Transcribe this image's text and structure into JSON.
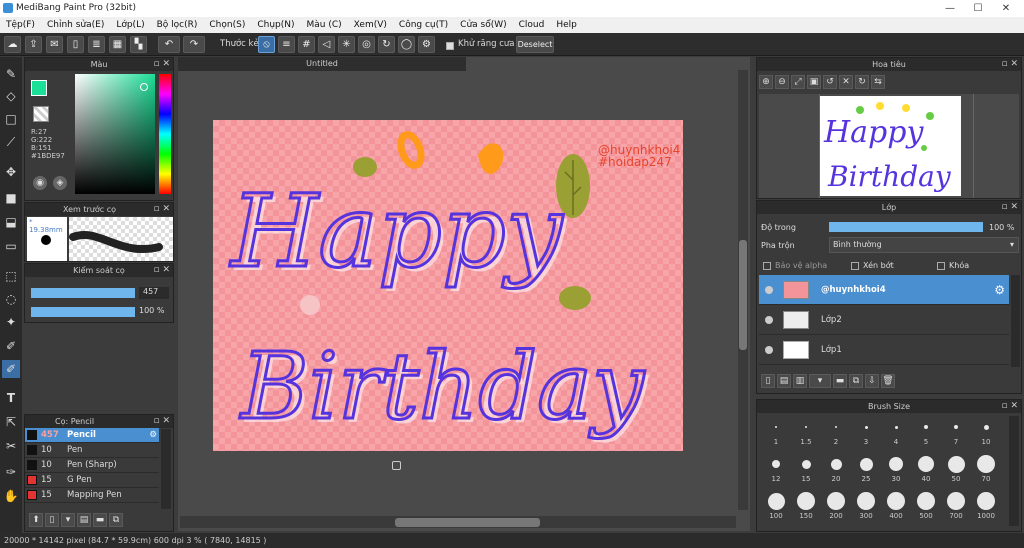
{
  "window": {
    "title": "MediBang Paint Pro (32bit)",
    "minimize": "—",
    "maximize": "☐",
    "close": "✕"
  },
  "menu": [
    "Tệp(F)",
    "Chỉnh sửa(E)",
    "Lớp(L)",
    "Bộ lọc(R)",
    "Chọn(S)",
    "Chụp(N)",
    "Màu (C)",
    "Xem(V)",
    "Công cụ(T)",
    "Cửa sổ(W)",
    "Cloud",
    "Help"
  ],
  "toolbar": {
    "stroke_label": "Thước kẻ",
    "antialias_label": "Khử răng cưa",
    "deselect_label": "Deselect"
  },
  "color_panel": {
    "title": "Màu",
    "r": "R:27",
    "g": "G:222",
    "b": "B:151",
    "hex": "#1BDE97",
    "primary": "#1bde97"
  },
  "brush_preview": {
    "title": "Xem trước cọ",
    "size": "* 19.38mm"
  },
  "brush_control": {
    "title": "Kiểm soát cọ",
    "size_value": "457",
    "opacity_value": "100 %"
  },
  "brush_list": {
    "title": "Cọ: Pencil",
    "items": [
      {
        "size": "457",
        "name": "Pencil",
        "color": "#111111"
      },
      {
        "size": "10",
        "name": "Pen",
        "color": "#111111"
      },
      {
        "size": "10",
        "name": "Pen (Sharp)",
        "color": "#111111"
      },
      {
        "size": "15",
        "name": "G Pen",
        "color": "#e33333"
      },
      {
        "size": "15",
        "name": "Mapping Pen",
        "color": "#e33333"
      }
    ]
  },
  "document": {
    "tab": "Untitled",
    "watermark_1": "@huynhkhoi4",
    "watermark_2": "#hoidap247",
    "text_1": "Happy",
    "text_2": "Birthday"
  },
  "navigator": {
    "title": "Hoa tiêu"
  },
  "layer_panel": {
    "title": "Lớp",
    "opacity_label": "Độ trong",
    "opacity_value": "100 %",
    "opacity_fraction": 1.0,
    "blend_label": "Pha trộn",
    "blend_value": "Bình thường",
    "protect_alpha": "Bảo vệ alpha",
    "clipping": "Xén bớt",
    "lock": "Khóa",
    "layers": [
      {
        "name": "@huynhkhoi4",
        "selected": true
      },
      {
        "name": "Lớp2",
        "selected": false
      },
      {
        "name": "Lớp1",
        "selected": false
      }
    ]
  },
  "brush_size_panel": {
    "title": "Brush Size",
    "sizes": [
      "1",
      "1.5",
      "2",
      "3",
      "4",
      "5",
      "7",
      "10",
      "12",
      "15",
      "20",
      "25",
      "30",
      "40",
      "50",
      "70",
      "100",
      "150",
      "200",
      "300",
      "400",
      "500",
      "700",
      "1000"
    ]
  },
  "status": {
    "text": "20000 * 14142 pixel  (84.7 * 59.9cm)  600 dpi  3 %  ( 7840, 14815 )"
  }
}
